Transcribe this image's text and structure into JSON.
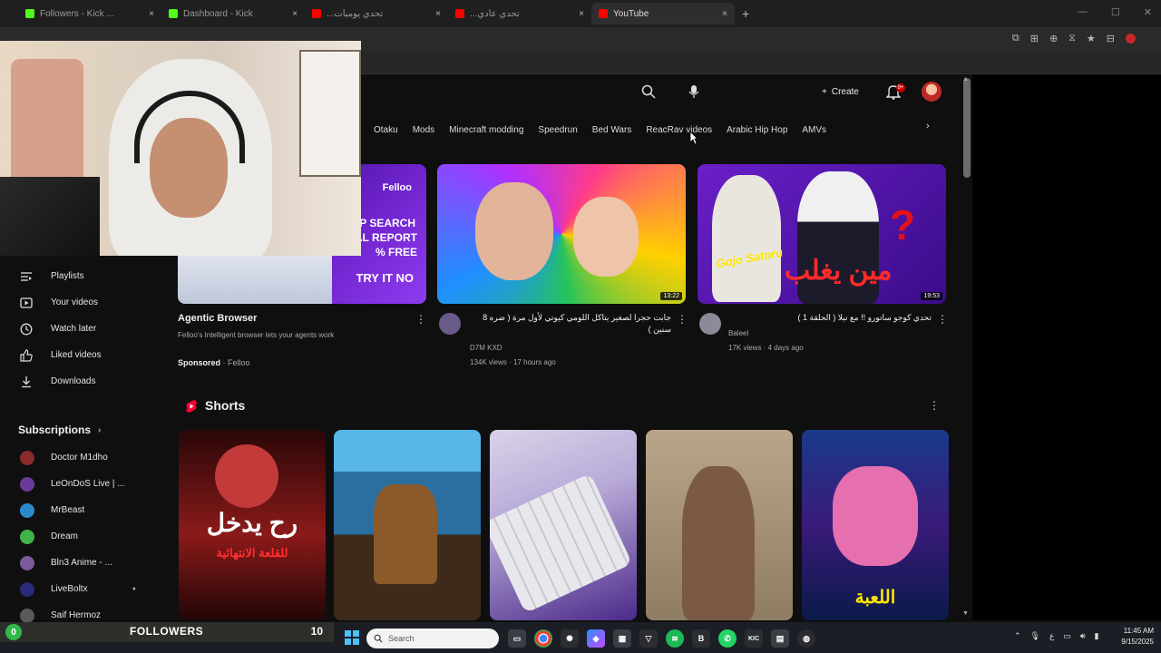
{
  "browser": {
    "tabs": [
      {
        "label": "Followers - Kick ...",
        "color": "#53fc18"
      },
      {
        "label": "Dashboard - Kick",
        "color": "#53fc18"
      },
      {
        "label": "...تحدي يوميات",
        "color": "#ff0000"
      },
      {
        "label": "...تحدي عادي",
        "color": "#ff0000"
      },
      {
        "label": "YouTube",
        "color": "#ff0000"
      }
    ],
    "new_tab": "+",
    "close": "×"
  },
  "masthead": {
    "create_label": "Create",
    "notification_count": "9+"
  },
  "chips": [
    "Otaku",
    "Mods",
    "Minecraft modding",
    "Speedrun",
    "Bed Wars",
    "ReacRav videos",
    "Arabic Hip Hop",
    "AMVs"
  ],
  "sidebar": {
    "items": [
      "Playlists",
      "Your videos",
      "Watch later",
      "Liked videos",
      "Downloads"
    ],
    "subscriptions_title": "Subscriptions",
    "subscriptions": [
      {
        "name": "Doctor M1dho",
        "color": "#8a2b2b"
      },
      {
        "name": "LeOnDoS Live | ...",
        "color": "#6a3b9a"
      },
      {
        "name": "MrBeast",
        "color": "#2b8acc"
      },
      {
        "name": "Dream",
        "color": "#41b34a"
      },
      {
        "name": "Bln3 Anime - ...",
        "color": "#7a5a9a"
      },
      {
        "name": "LiveBoltx",
        "color": "#2a2a7a"
      },
      {
        "name": "Saif Hermoz",
        "color": "#5a5a5a"
      }
    ]
  },
  "videos": [
    {
      "title": "Agentic Browser",
      "desc": "Felloo's Intelligent browser lets your agents work",
      "sponsored": "Sponsored",
      "advertiser": "Felloo",
      "thumb_text": [
        "Felloo",
        "EP SEARCH",
        "UAL REPORT",
        "% FREE",
        "TRY IT NO"
      ]
    },
    {
      "title": "جابت حجرا لصغير يتاكل اللومي كيوتي لأول مرة ( ضره 8 سنين )",
      "channel": "D7M KXD",
      "meta": "134K views · 17 hours ago",
      "duration": "13:22"
    },
    {
      "title": "تحدي كوجو ساتورو !! مع نيلا ( الحلقة 1 )",
      "channel": "Baleel",
      "meta": "17K views · 4 days ago",
      "duration": "19:53",
      "thumb_caption": "مين يغلب",
      "thumb_tag": "Gojo Satoru"
    }
  ],
  "shorts": {
    "title": "Shorts",
    "items": [
      {
        "caption": "رح يدخل",
        "sub": "للقلعة الانتهائية"
      },
      {
        "caption": ""
      },
      {
        "caption": ""
      },
      {
        "caption": ""
      },
      {
        "caption": "اللعبة"
      }
    ]
  },
  "overlay": {
    "followers_count": "0",
    "followers_label": "FOLLOWERS",
    "followers_goal": "10"
  },
  "taskbar": {
    "search_placeholder": "Search",
    "time": "11:45 AM",
    "date": "9/15/2025",
    "lang": "ع"
  }
}
